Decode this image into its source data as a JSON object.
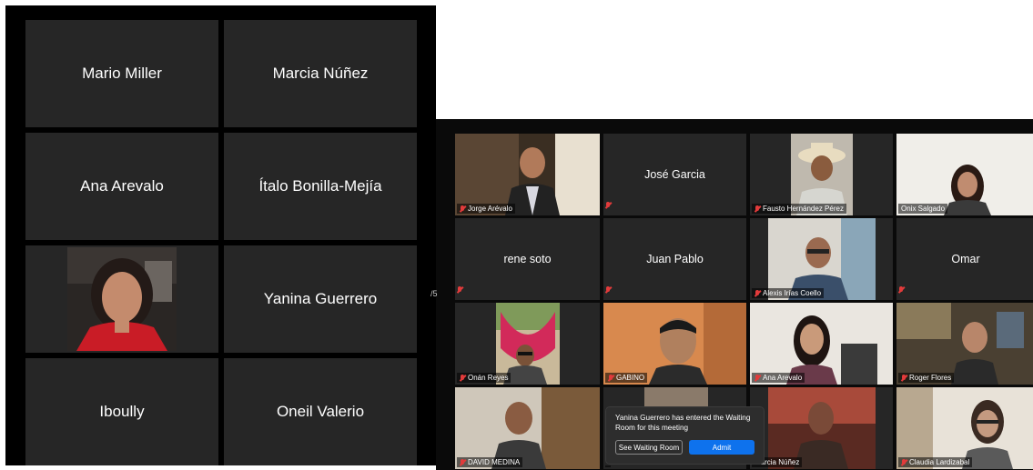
{
  "left_meeting": {
    "participants": [
      {
        "name": "Mario Miller"
      },
      {
        "name": "Marcia Núñez"
      },
      {
        "name": "Ana Arevalo"
      },
      {
        "name": "Ítalo Bonilla-Mejía"
      },
      {
        "name": ""
      },
      {
        "name": "Yanina Guerrero"
      },
      {
        "name": "Iboully"
      },
      {
        "name": "Oneil Valerio"
      }
    ],
    "side_indicator": "/5"
  },
  "right_meeting": {
    "tiles": [
      {
        "label": "Jorge Arévalo"
      },
      {
        "center_name": "José Garcia"
      },
      {
        "label": "Fausto Hernández Pérez"
      },
      {
        "label": "Onix Salgado"
      },
      {
        "center_name": "rene soto"
      },
      {
        "center_name": "Juan Pablo"
      },
      {
        "label": "Alexis Irías Coello"
      },
      {
        "center_name": "Omar"
      },
      {
        "label": "Onán Reyes"
      },
      {
        "label": "GABINO"
      },
      {
        "label": "Ana Arevalo"
      },
      {
        "label": "Roger Flores"
      },
      {
        "label": "DAVID MEDINA"
      },
      {
        "label": ""
      },
      {
        "label": "Marcia Núñez"
      },
      {
        "label": "Claudia Lardizabal"
      }
    ]
  },
  "waiting_room": {
    "message": "Yanina Guerrero has entered the Waiting Room for this meeting",
    "see_button": "See Waiting Room",
    "admit_button": "Admit"
  },
  "colors": {
    "tile_bg": "#262626",
    "active_border": "#c6e06a",
    "admit_blue": "#0e72ed",
    "muted_red": "#e23b3b"
  }
}
